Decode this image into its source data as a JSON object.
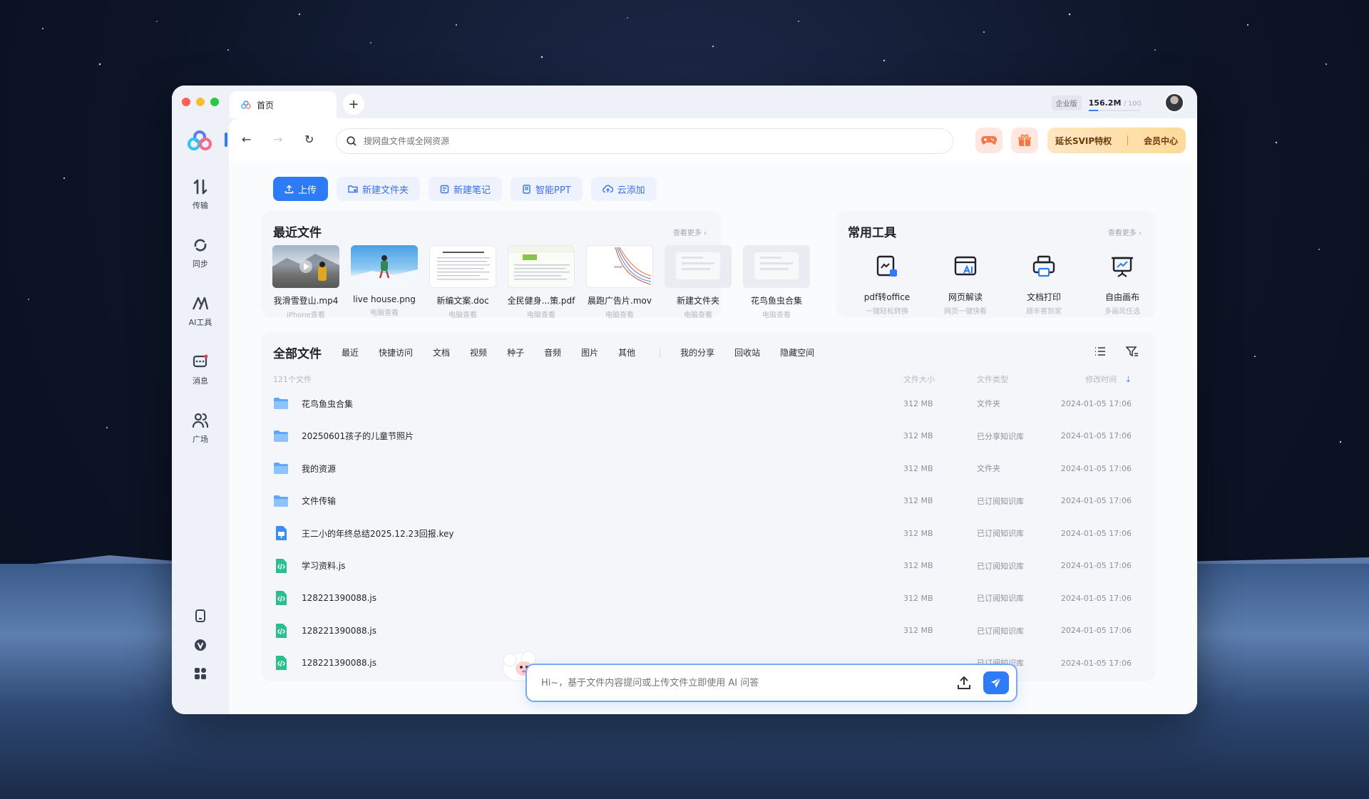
{
  "colors": {
    "accent": "#2e7bf6",
    "svip_text": "#6b3b0a",
    "folder": "#5ea8f7"
  },
  "titlebar": {
    "tab_label": "首页",
    "tab_icon": "cloud-logo-icon",
    "enterprise_badge": "企业版",
    "storage_used": "156.2M",
    "storage_total": "/ 10G"
  },
  "sidebar": {
    "items": [
      {
        "label": "传输",
        "icon": "transfer-icon"
      },
      {
        "label": "同步",
        "icon": "sync-icon"
      },
      {
        "label": "AI工具",
        "icon": "ai-icon"
      },
      {
        "label": "消息",
        "icon": "message-icon"
      },
      {
        "label": "广场",
        "icon": "people-icon"
      }
    ],
    "bottom_icons": [
      "device-icon",
      "vip-icon",
      "apps-icon"
    ]
  },
  "toolbar": {
    "search_placeholder": "搜网盘文件或全网资源",
    "svip_label": "延长SVIP特权",
    "member_label": "会员中心"
  },
  "actions": [
    {
      "label": "上传",
      "icon": "upload-icon"
    },
    {
      "label": "新建文件夹",
      "icon": "new-folder-icon"
    },
    {
      "label": "新建笔记",
      "icon": "note-icon"
    },
    {
      "label": "智能PPT",
      "icon": "ppt-icon"
    },
    {
      "label": "云添加",
      "icon": "cloud-add-icon"
    }
  ],
  "recent": {
    "title": "最近文件",
    "more": "查看更多 ›",
    "items": [
      {
        "name": "我滑雪登山.mp4",
        "sub": "iPhone查看"
      },
      {
        "name": "live house.png",
        "sub": "电脑查看"
      },
      {
        "name": "新编文案.doc",
        "sub": "电脑查看"
      },
      {
        "name": "全民健身...策.pdf",
        "sub": "电脑查看"
      },
      {
        "name": "晨跑广告片.mov",
        "sub": "电脑查看"
      },
      {
        "name": "新建文件夹",
        "sub": "电脑查看"
      },
      {
        "name": "花鸟鱼虫合集",
        "sub": "电脑查看"
      }
    ]
  },
  "tools": {
    "title": "常用工具",
    "more": "查看更多 ›",
    "items": [
      {
        "name": "pdf转office",
        "sub": "一键轻松转换"
      },
      {
        "name": "网页解读",
        "sub": "网页一键快看"
      },
      {
        "name": "文档打印",
        "sub": "顺丰寄到家"
      },
      {
        "name": "自由画布",
        "sub": "多画风任选"
      }
    ]
  },
  "files": {
    "title": "全部文件",
    "categories": [
      "最近",
      "快捷访问",
      "文档",
      "视频",
      "种子",
      "音频",
      "图片",
      "其他"
    ],
    "extra": [
      "我的分享",
      "回收站",
      "隐藏空间"
    ],
    "count": "121个文件",
    "col_size": "文件大小",
    "col_type": "文件类型",
    "col_time": "修改时间",
    "rows": [
      {
        "name": "花鸟鱼虫合集",
        "size": "312 MB",
        "type": "文件夹",
        "time": "2024-01-05 17:06",
        "kind": "folder"
      },
      {
        "name": "20250601孩子的儿童节照片",
        "size": "312 MB",
        "type": "已分享知识库",
        "time": "2024-01-05 17:06",
        "kind": "folder"
      },
      {
        "name": "我的资源",
        "size": "312 MB",
        "type": "文件夹",
        "time": "2024-01-05 17:06",
        "kind": "folder"
      },
      {
        "name": "文件传输",
        "size": "312 MB",
        "type": "已订阅知识库",
        "time": "2024-01-05 17:06",
        "kind": "folder"
      },
      {
        "name": "王二小的年终总结2025.12.23回报.key",
        "size": "312 MB",
        "type": "已订阅知识库",
        "time": "2024-01-05 17:06",
        "kind": "key"
      },
      {
        "name": "学习资料.js",
        "size": "312 MB",
        "type": "已订阅知识库",
        "time": "2024-01-05 17:06",
        "kind": "js"
      },
      {
        "name": "128221390088.js",
        "size": "312 MB",
        "type": "已订阅知识库",
        "time": "2024-01-05 17:06",
        "kind": "js"
      },
      {
        "name": "128221390088.js",
        "size": "312 MB",
        "type": "已订阅知识库",
        "time": "2024-01-05 17:06",
        "kind": "js"
      },
      {
        "name": "128221390088.js",
        "size": "",
        "type": "已订阅知识库",
        "time": "2024-01-05 17:06",
        "kind": "js"
      }
    ]
  },
  "ai": {
    "placeholder": "Hi~，基于文件内容提问或上传文件立即使用 AI 问答"
  }
}
